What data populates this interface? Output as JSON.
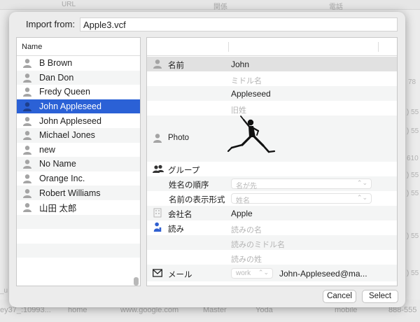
{
  "background": {
    "headers": [
      "URL",
      "関係",
      "電話"
    ],
    "right_fragments": [
      "78",
      ") 55",
      ") 55",
      "610",
      ") 55",
      ") 55",
      ") 55",
      ") 55"
    ],
    "left_fragments": [
      "ey37_:10993...",
      "_u"
    ],
    "bottom_row": [
      "home",
      "www.google.com",
      "Master",
      "Yoda",
      "mobile",
      "888-555"
    ]
  },
  "dialog": {
    "import_label": "Import from:",
    "import_value": "Apple3.vcf",
    "list_header": "Name",
    "contacts": [
      "B Brown",
      "Dan Don",
      "Fredy Queen",
      "John Appleseed",
      "John Appleseed",
      "Michael Jones",
      "new",
      "No Name",
      "Orange Inc.",
      "Robert Williams",
      "山田 太郎"
    ],
    "selected_index": 3,
    "detail": {
      "name_label": "名前",
      "first_name": "John",
      "middle_placeholder": "ミドル名",
      "last_name": "Appleseed",
      "former_placeholder": "旧姓",
      "photo_label": "Photo",
      "group_label": "グループ",
      "name_order_label": "姓名の順序",
      "name_order_value": "名が先",
      "display_label": "名前の表示形式",
      "display_value": "姓名",
      "company_label": "会社名",
      "company_value": "Apple",
      "reading_label": "読み",
      "reading_first_ph": "読みの名",
      "reading_middle_ph": "読みのミドル名",
      "reading_last_ph": "読みの姓",
      "mail_label": "メール",
      "mail_type": "work",
      "mail_value": "John-Appleseed@ma..."
    },
    "cancel_label": "Cancel",
    "select_label": "Select",
    "accent_color": "#2b61d6"
  }
}
